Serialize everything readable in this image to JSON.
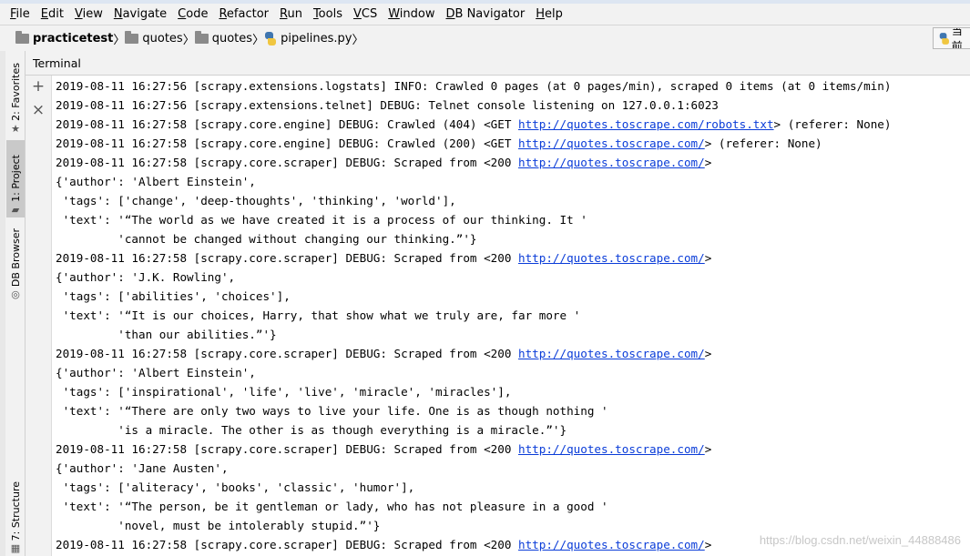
{
  "menu": [
    {
      "mnemonic": "F",
      "rest": "ile"
    },
    {
      "mnemonic": "E",
      "rest": "dit"
    },
    {
      "mnemonic": "V",
      "rest": "iew"
    },
    {
      "mnemonic": "N",
      "rest": "avigate"
    },
    {
      "mnemonic": "C",
      "rest": "ode"
    },
    {
      "mnemonic": "R",
      "rest": "efactor"
    },
    {
      "mnemonic": "R",
      "rest": "un"
    },
    {
      "mnemonic": "T",
      "rest": "ools"
    },
    {
      "mnemonic": "V",
      "rest": "CS"
    },
    {
      "mnemonic": "W",
      "rest": "indow"
    },
    {
      "mnemonic": "D",
      "rest": "B Navigator"
    },
    {
      "mnemonic": "H",
      "rest": "elp"
    }
  ],
  "breadcrumb": {
    "project": "practicetest",
    "folder1": "quotes",
    "folder2": "quotes",
    "file": "pipelines.py"
  },
  "run_config": {
    "label": "当前"
  },
  "left_stripe": {
    "favorites": "2: Favorites",
    "project": "1: Project",
    "db_browser": "DB Browser",
    "structure": "7: Structure"
  },
  "terminal": {
    "title": "Terminal",
    "add_icon": "+",
    "close_icon": "×"
  },
  "console_lines": [
    {
      "text": "2019-08-11 16:27:56 [scrapy.extensions.logstats] INFO: Crawled 0 pages (at 0 pages/min), scraped 0 items (at 0 items/min)",
      "link": "",
      "after": ""
    },
    {
      "text": "2019-08-11 16:27:56 [scrapy.extensions.telnet] DEBUG: Telnet console listening on 127.0.0.1:6023",
      "link": "",
      "after": ""
    },
    {
      "text": "2019-08-11 16:27:58 [scrapy.core.engine] DEBUG: Crawled (404) <GET ",
      "link": "http://quotes.toscrape.com/robots.txt",
      "after": "> (referer: None)"
    },
    {
      "text": "2019-08-11 16:27:58 [scrapy.core.engine] DEBUG: Crawled (200) <GET ",
      "link": "http://quotes.toscrape.com/",
      "after": "> (referer: None)"
    },
    {
      "text": "2019-08-11 16:27:58 [scrapy.core.scraper] DEBUG: Scraped from <200 ",
      "link": "http://quotes.toscrape.com/",
      "after": ">"
    },
    {
      "text": "{'author': 'Albert Einstein',",
      "link": "",
      "after": ""
    },
    {
      "text": " 'tags': ['change', 'deep-thoughts', 'thinking', 'world'],",
      "link": "",
      "after": ""
    },
    {
      "text": " 'text': '“The world as we have created it is a process of our thinking. It '",
      "link": "",
      "after": ""
    },
    {
      "text": "         'cannot be changed without changing our thinking.”'}",
      "link": "",
      "after": ""
    },
    {
      "text": "2019-08-11 16:27:58 [scrapy.core.scraper] DEBUG: Scraped from <200 ",
      "link": "http://quotes.toscrape.com/",
      "after": ">"
    },
    {
      "text": "{'author': 'J.K. Rowling',",
      "link": "",
      "after": ""
    },
    {
      "text": " 'tags': ['abilities', 'choices'],",
      "link": "",
      "after": ""
    },
    {
      "text": " 'text': '“It is our choices, Harry, that show what we truly are, far more '",
      "link": "",
      "after": ""
    },
    {
      "text": "         'than our abilities.”'}",
      "link": "",
      "after": ""
    },
    {
      "text": "2019-08-11 16:27:58 [scrapy.core.scraper] DEBUG: Scraped from <200 ",
      "link": "http://quotes.toscrape.com/",
      "after": ">"
    },
    {
      "text": "{'author': 'Albert Einstein',",
      "link": "",
      "after": ""
    },
    {
      "text": " 'tags': ['inspirational', 'life', 'live', 'miracle', 'miracles'],",
      "link": "",
      "after": ""
    },
    {
      "text": " 'text': '“There are only two ways to live your life. One is as though nothing '",
      "link": "",
      "after": ""
    },
    {
      "text": "         'is a miracle. The other is as though everything is a miracle.”'}",
      "link": "",
      "after": ""
    },
    {
      "text": "2019-08-11 16:27:58 [scrapy.core.scraper] DEBUG: Scraped from <200 ",
      "link": "http://quotes.toscrape.com/",
      "after": ">"
    },
    {
      "text": "{'author': 'Jane Austen',",
      "link": "",
      "after": ""
    },
    {
      "text": " 'tags': ['aliteracy', 'books', 'classic', 'humor'],",
      "link": "",
      "after": ""
    },
    {
      "text": " 'text': '“The person, be it gentleman or lady, who has not pleasure in a good '",
      "link": "",
      "after": ""
    },
    {
      "text": "         'novel, must be intolerably stupid.”'}",
      "link": "",
      "after": ""
    },
    {
      "text": "2019-08-11 16:27:58 [scrapy.core.scraper] DEBUG: Scraped from <200 ",
      "link": "http://quotes.toscrape.com/",
      "after": ">"
    }
  ],
  "watermark": "https://blog.csdn.net/weixin_44888486",
  "colors": {
    "link": "#0a3cd8",
    "panel": "#f2f2f2"
  }
}
